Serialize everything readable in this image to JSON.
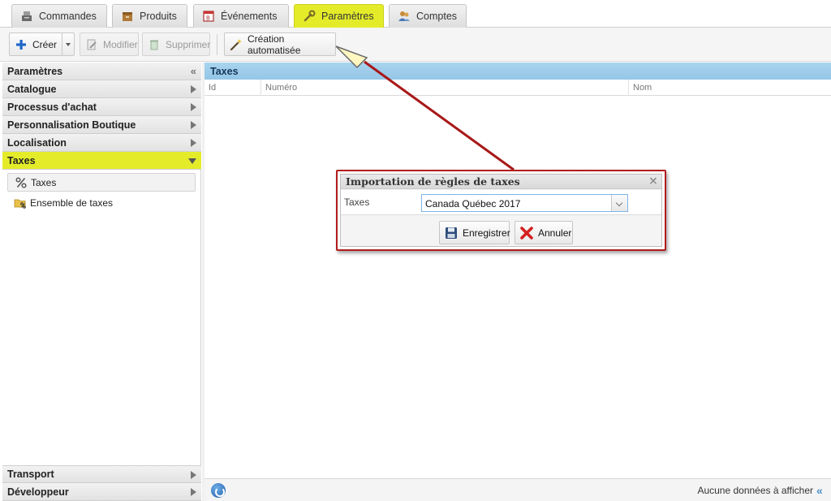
{
  "tabs": [
    {
      "label": "Commandes",
      "icon": "register-icon",
      "active": false
    },
    {
      "label": "Produits",
      "icon": "box-icon",
      "active": false
    },
    {
      "label": "Événements",
      "icon": "calendar-icon",
      "active": false
    },
    {
      "label": "Paramètres",
      "icon": "wrench-icon",
      "active": true
    },
    {
      "label": "Comptes",
      "icon": "users-icon",
      "active": false
    }
  ],
  "toolbar": {
    "create_label": "Créer",
    "modify_label": "Modifier",
    "delete_label": "Supprimer",
    "auto_create_label": "Création automatisée"
  },
  "sidebar": {
    "header": "Paramètres",
    "collapse_glyph": "«",
    "sections": [
      {
        "label": "Catalogue"
      },
      {
        "label": "Processus d'achat"
      },
      {
        "label": "Personnalisation Boutique"
      },
      {
        "label": "Localisation"
      },
      {
        "label": "Taxes",
        "active": true
      }
    ],
    "tree": [
      {
        "label": "Taxes",
        "icon": "percent-icon",
        "selected": true
      },
      {
        "label": "Ensemble de taxes",
        "icon": "folder-percent-icon",
        "selected": false
      }
    ],
    "bottom_sections": [
      {
        "label": "Transport"
      },
      {
        "label": "Développeur"
      }
    ]
  },
  "grid": {
    "title": "Taxes",
    "columns": [
      "Id",
      "Numéro",
      "Nom"
    ],
    "status": "Aucune données à afficher"
  },
  "dialog": {
    "title": "Importation de règles de taxes",
    "field_label": "Taxes",
    "field_value": "Canada Québec 2017",
    "save_label": "Enregistrer",
    "cancel_label": "Annuler"
  },
  "colors": {
    "accent_yellow": "#e4ec2a",
    "grid_header_blue": "#a8d4ee",
    "annotation_red": "#b21c1c"
  }
}
